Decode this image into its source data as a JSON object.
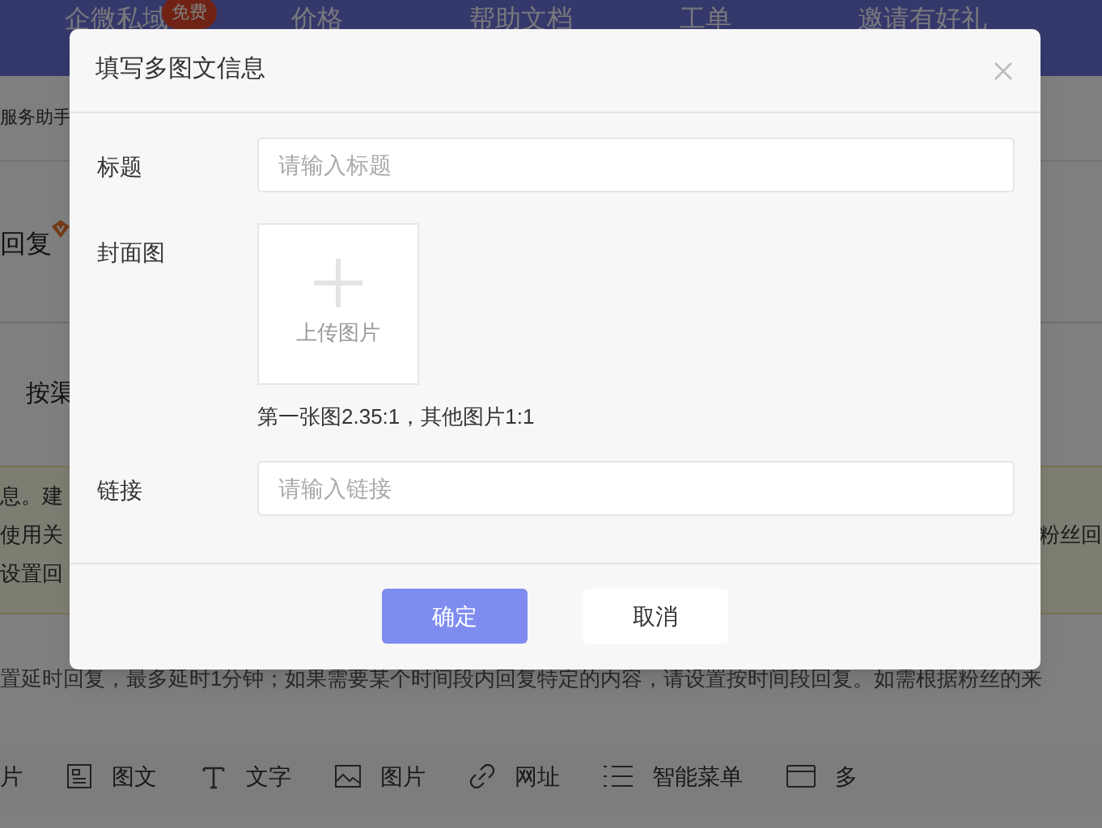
{
  "background_page": {
    "nav": [
      {
        "label": "企微私域",
        "badge": "免费"
      },
      {
        "label": "价格"
      },
      {
        "label": "帮助文档"
      },
      {
        "label": "工单"
      },
      {
        "label": "邀请有好礼"
      }
    ],
    "breadcrumb": "服务助手",
    "section_title": "回复",
    "tab_label": "按渠",
    "notice_lines": [
      "息。建",
      "使用关",
      "设置回"
    ],
    "notice_right": "粉丝回",
    "description": "置延时回复，最多延时1分钟；如果需要某个时间段内回复特定的内容，请设置按时间段回复。如需根据粉丝的来",
    "toolbar": [
      {
        "kind": "none",
        "label": "片"
      },
      {
        "kind": "news",
        "label": "图文"
      },
      {
        "kind": "text",
        "label": "文字"
      },
      {
        "kind": "image",
        "label": "图片"
      },
      {
        "kind": "link",
        "label": "网址"
      },
      {
        "kind": "menu",
        "label": "智能菜单"
      },
      {
        "kind": "card",
        "label": "多"
      }
    ]
  },
  "dialog": {
    "title": "填写多图文信息",
    "fields": [
      {
        "kind": "input",
        "label": "标题",
        "placeholder": "请输入标题"
      },
      {
        "kind": "upload",
        "label": "封面图",
        "upload_label": "上传图片",
        "hint": "第一张图2.35:1，其他图片1:1"
      },
      {
        "kind": "input",
        "label": "链接",
        "placeholder": "请输入链接"
      }
    ],
    "buttons": [
      {
        "label": "确定",
        "primary": true
      },
      {
        "label": "取消",
        "primary": false
      }
    ]
  }
}
